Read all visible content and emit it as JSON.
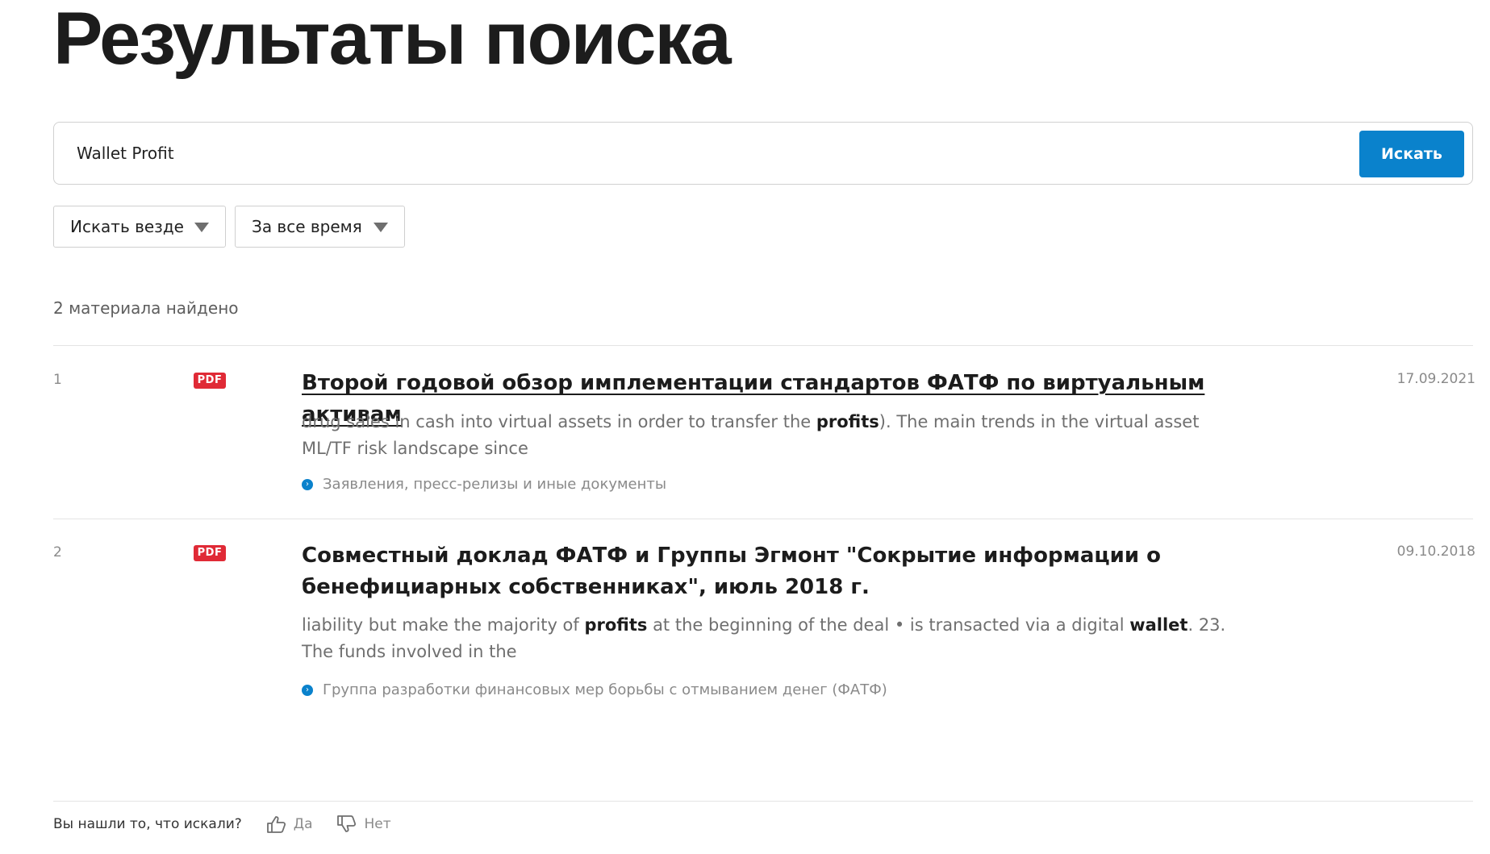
{
  "page": {
    "title": "Результаты поиска"
  },
  "search": {
    "query": "Wallet Profit",
    "button_label": "Искать"
  },
  "filters": {
    "scope": "Искать везде",
    "period": "За все время"
  },
  "summary": {
    "found": "2 материала найдено"
  },
  "results": [
    {
      "number": "1",
      "badge": "PDF",
      "title": "Второй годовой обзор имплементации стандартов ФАТФ по виртуальным активам",
      "snippet": [
        {
          "text": "drug sales in cash into virtual assets in order to transfer the ",
          "bold": false
        },
        {
          "text": "profits",
          "bold": true
        },
        {
          "text": "). The main trends in the virtual asset ML/TF risk landscape since",
          "bold": false
        }
      ],
      "category": "Заявления, пресс-релизы и иные документы",
      "date": "17.09.2021"
    },
    {
      "number": "2",
      "badge": "PDF",
      "title": "Совместный доклад ФАТФ и Группы Эгмонт \"Сокрытие информации о бенефициарных собственниках\", июль 2018 г.",
      "snippet": [
        {
          "text": "liability but make the majority of ",
          "bold": false
        },
        {
          "text": "profits",
          "bold": true
        },
        {
          "text": " at the beginning of the deal • is transacted via a digital ",
          "bold": false
        },
        {
          "text": "wallet",
          "bold": true
        },
        {
          "text": ". 23. The funds involved in the",
          "bold": false
        }
      ],
      "category": "Группа разработки финансовых мер борьбы с отмыванием денег (ФАТФ)",
      "date": "09.10.2018"
    }
  ],
  "feedback": {
    "question": "Вы нашли то, что искали?",
    "yes_label": "Да",
    "no_label": "Нет"
  },
  "colors": {
    "accent": "#0a82cc",
    "pdf_badge": "#e02a36"
  },
  "icons": {
    "dropdown": "caret-down-icon",
    "category": "arrow-circle-icon",
    "yes": "thumbs-up-icon",
    "no": "thumbs-down-icon"
  }
}
